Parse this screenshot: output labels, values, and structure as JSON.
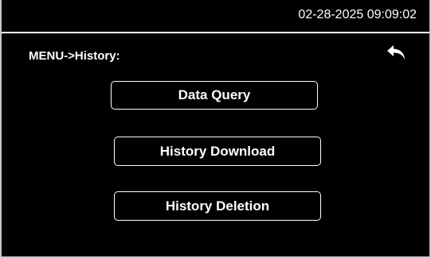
{
  "header": {
    "datetime": "02-28-2025 09:09:02"
  },
  "breadcrumb": "MENU->History:",
  "menu": {
    "items": [
      {
        "label": "Data Query"
      },
      {
        "label": "History Download"
      },
      {
        "label": "History Deletion"
      }
    ]
  },
  "icons": {
    "back": "back-arrow-icon"
  },
  "colors": {
    "background": "#000000",
    "foreground": "#ffffff"
  }
}
